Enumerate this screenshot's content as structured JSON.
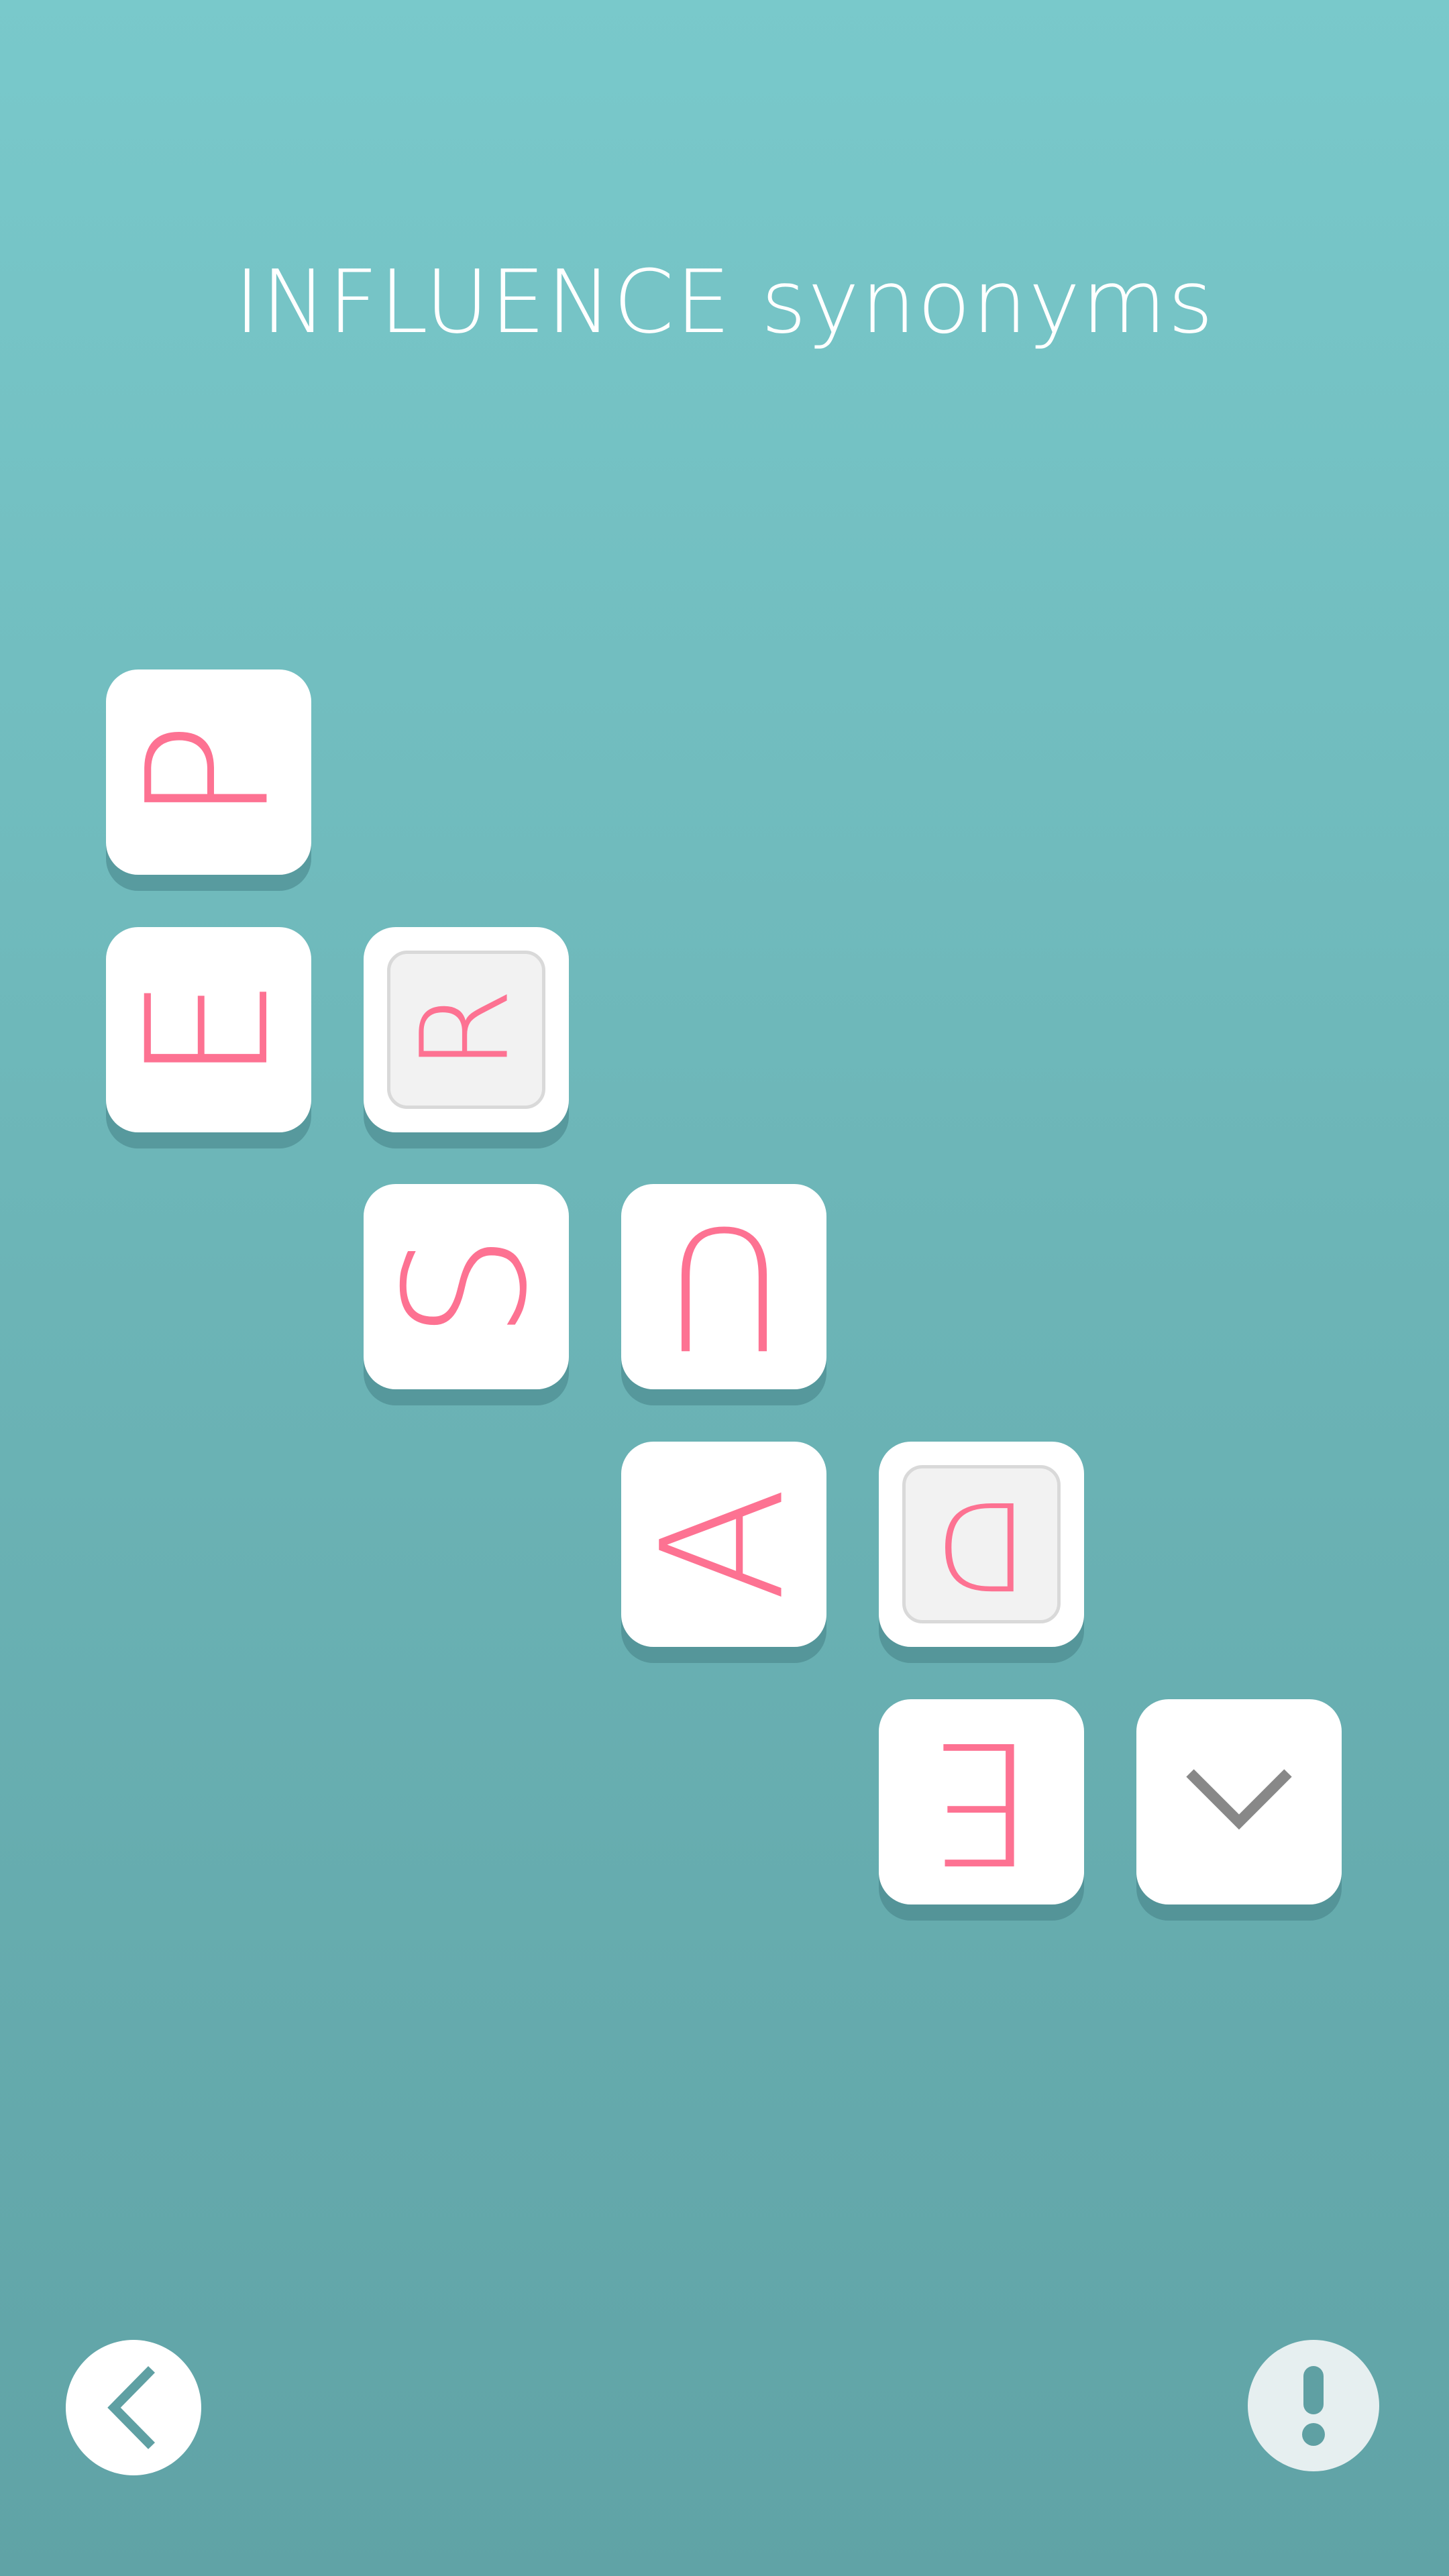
{
  "puzzle": {
    "title": "INFLUENCE synonyms"
  },
  "tiles": [
    {
      "letter": "P",
      "state": "normal"
    },
    {
      "letter": "E",
      "state": "normal"
    },
    {
      "letter": "R",
      "state": "selected"
    },
    {
      "letter": "S",
      "state": "normal"
    },
    {
      "letter": "U",
      "state": "normal"
    },
    {
      "letter": "A",
      "state": "normal"
    },
    {
      "letter": "D",
      "state": "selected"
    },
    {
      "letter": "E",
      "state": "normal"
    }
  ],
  "colors": {
    "letter": "#fd7292",
    "tile": "#ffffff",
    "selected_tile": "#f2f2f2",
    "icon": "#5fa0a3"
  },
  "icons": {
    "confirm": "chevron-down-icon",
    "back": "chevron-left-icon",
    "hint": "exclamation-icon"
  }
}
